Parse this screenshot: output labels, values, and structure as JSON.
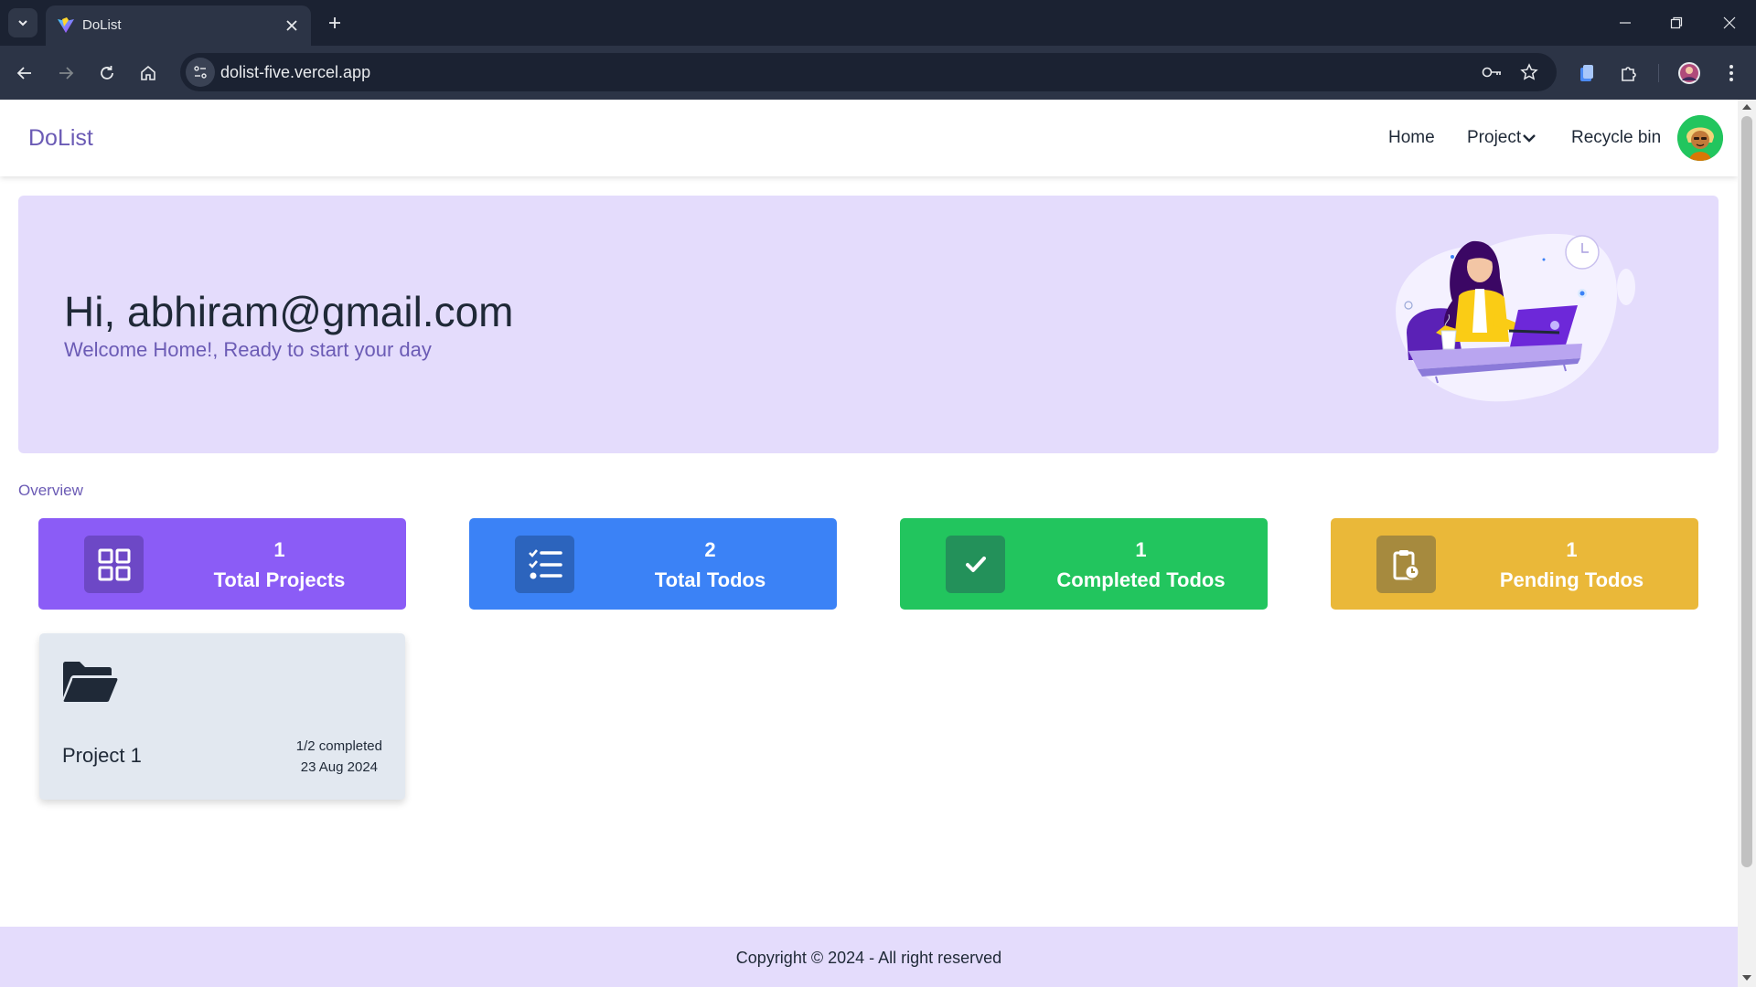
{
  "browser": {
    "tab_title": "DoList",
    "url": "dolist-five.vercel.app"
  },
  "navbar": {
    "brand": "DoList",
    "links": [
      {
        "label": "Home"
      },
      {
        "label": "Project"
      },
      {
        "label": "Recycle bin"
      }
    ]
  },
  "hero": {
    "greeting": "Hi, abhiram@gmail.com",
    "subtitle": "Welcome Home!, Ready to start your day"
  },
  "overview": {
    "heading": "Overview",
    "stats": [
      {
        "count": "1",
        "label": "Total Projects",
        "color": "#8b5cf6",
        "icon_bg": "#6d48c6",
        "icon": "grid-icon"
      },
      {
        "count": "2",
        "label": "Total Todos",
        "color": "#3b82f6",
        "icon_bg": "#2c64bd",
        "icon": "checklist-icon"
      },
      {
        "count": "1",
        "label": "Completed Todos",
        "color": "#22c55e",
        "icon_bg": "#23915a",
        "icon": "check-icon"
      },
      {
        "count": "1",
        "label": "Pending Todos",
        "color": "#eab839",
        "icon_bg": "#a68a3e",
        "icon": "clipboard-clock-icon"
      }
    ]
  },
  "projects": [
    {
      "name": "Project 1",
      "progress": "1/2 completed",
      "date": "23 Aug 2024"
    }
  ],
  "footer": {
    "text": "Copyright © 2024 - All right reserved"
  },
  "colors": {
    "brand": "#6b5bb5",
    "hero_bg": "#e4dcfc",
    "chrome_dark": "#1b2232",
    "chrome_mid": "#2c3446"
  }
}
